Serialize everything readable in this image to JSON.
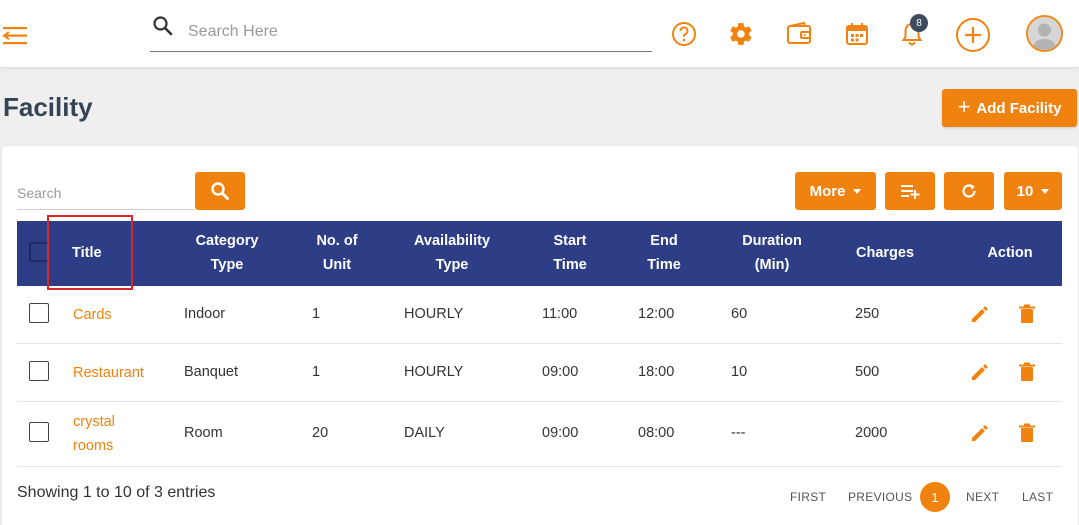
{
  "colors": {
    "accent": "#f0820f",
    "header_blue": "#2e3e86",
    "title_color": "#354356"
  },
  "topbar": {
    "search_placeholder": "Search Here",
    "icons": [
      "menu-collapse-icon",
      "search-icon",
      "help-icon",
      "gear-icon",
      "wallet-icon",
      "calendar-icon",
      "bell-icon",
      "add-circle-icon",
      "user-avatar"
    ],
    "notification_count": "8"
  },
  "page": {
    "title": "Facility",
    "add_button_label": "Add Facility"
  },
  "toolbar": {
    "search_placeholder": "Search",
    "more_label": "More",
    "page_size_label": "10"
  },
  "table": {
    "headers": {
      "title": "Title",
      "category_line1": "Category",
      "category_line2": "Type",
      "units_line1": "No. of",
      "units_line2": "Unit",
      "availability_line1": "Availability",
      "availability_line2": "Type",
      "start_line1": "Start",
      "start_line2": "Time",
      "end_line1": "End",
      "end_line2": "Time",
      "duration_line1": "Duration",
      "duration_line2": "(Min)",
      "charges": "Charges",
      "action": "Action"
    },
    "rows": [
      {
        "title": "Cards",
        "title_line2": "",
        "category": "Indoor",
        "units": "1",
        "availability": "HOURLY",
        "start": "11:00",
        "end": "12:00",
        "duration": "60",
        "charges": "250"
      },
      {
        "title": "Restaurant",
        "title_line2": "",
        "category": "Banquet",
        "units": "1",
        "availability": "HOURLY",
        "start": "09:00",
        "end": "18:00",
        "duration": "10",
        "charges": "500"
      },
      {
        "title": "crystal",
        "title_line2": "rooms",
        "category": "Room",
        "units": "20",
        "availability": "DAILY",
        "start": "09:00",
        "end": "08:00",
        "duration": "---",
        "charges": "2000"
      }
    ]
  },
  "footer": {
    "showing_text": "Showing 1 to 10 of 3 entries",
    "pagination": {
      "first": "FIRST",
      "previous": "PREVIOUS",
      "current": "1",
      "next": "NEXT",
      "last": "LAST"
    }
  }
}
